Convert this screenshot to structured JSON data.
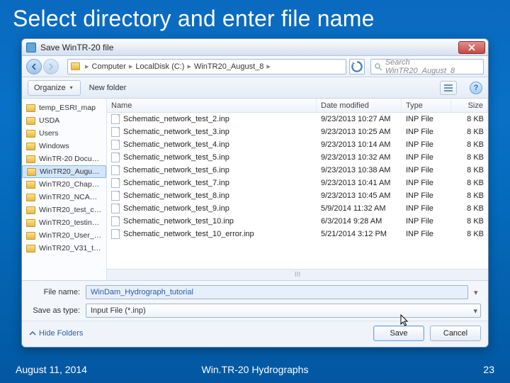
{
  "slide": {
    "title": "Select directory and enter file name",
    "date": "August 11, 2014",
    "footer_center": "Win.TR-20 Hydrographs",
    "page": "23"
  },
  "dialog": {
    "title": "Save WinTR-20 file",
    "close_glyph": "✕",
    "breadcrumb": [
      "Computer",
      "LocalDisk (C:)",
      "WinTR20_August_8"
    ],
    "search_placeholder": "Search WinTR20_August_8",
    "organize_label": "Organize",
    "newfolder_label": "New folder",
    "help_glyph": "?",
    "columns": {
      "name": "Name",
      "date": "Date modified",
      "type": "Type",
      "size": "Size"
    },
    "sidebar": [
      "temp_ESRI_map",
      "USDA",
      "Users",
      "Windows",
      "WinTR-20 Docu…",
      "WinTR20_Augu…",
      "WinTR20_Chap…",
      "WinTR20_NCA…",
      "WinTR20_test_c…",
      "WinTR20_testin…",
      "WinTR20_User_…",
      "WinTR20_V31_t…"
    ],
    "sidebar_selected_index": 5,
    "files": [
      {
        "name": "Schematic_network_test_2.inp",
        "date": "9/23/2013 10:27 AM",
        "type": "INP File",
        "size": "8 KB"
      },
      {
        "name": "Schematic_network_test_3.inp",
        "date": "9/23/2013 10:25 AM",
        "type": "INP File",
        "size": "8 KB"
      },
      {
        "name": "Schematic_network_test_4.inp",
        "date": "9/23/2013 10:14 AM",
        "type": "INP File",
        "size": "8 KB"
      },
      {
        "name": "Schematic_network_test_5.inp",
        "date": "9/23/2013 10:32 AM",
        "type": "INP File",
        "size": "8 KB"
      },
      {
        "name": "Schematic_network_test_6.inp",
        "date": "9/23/2013 10:38 AM",
        "type": "INP File",
        "size": "8 KB"
      },
      {
        "name": "Schematic_network_test_7.inp",
        "date": "9/23/2013 10:41 AM",
        "type": "INP File",
        "size": "8 KB"
      },
      {
        "name": "Schematic_network_test_8.inp",
        "date": "9/23/2013 10:45 AM",
        "type": "INP File",
        "size": "8 KB"
      },
      {
        "name": "Schematic_network_test_9.inp",
        "date": "5/9/2014 11:32 AM",
        "type": "INP File",
        "size": "8 KB"
      },
      {
        "name": "Schematic_network_test_10.inp",
        "date": "6/3/2014 9:28 AM",
        "type": "INP File",
        "size": "8 KB"
      },
      {
        "name": "Schematic_network_test_10_error.inp",
        "date": "5/21/2014 3:12 PM",
        "type": "INP File",
        "size": "8 KB"
      }
    ],
    "filename_label": "File name:",
    "filename_value": "WinDam_Hydrograph_tutorial",
    "saveastype_label": "Save as type:",
    "saveastype_value": "Input File (*.inp)",
    "hide_folders_label": "Hide Folders",
    "save_label": "Save",
    "cancel_label": "Cancel",
    "scroll_marker": "III"
  }
}
